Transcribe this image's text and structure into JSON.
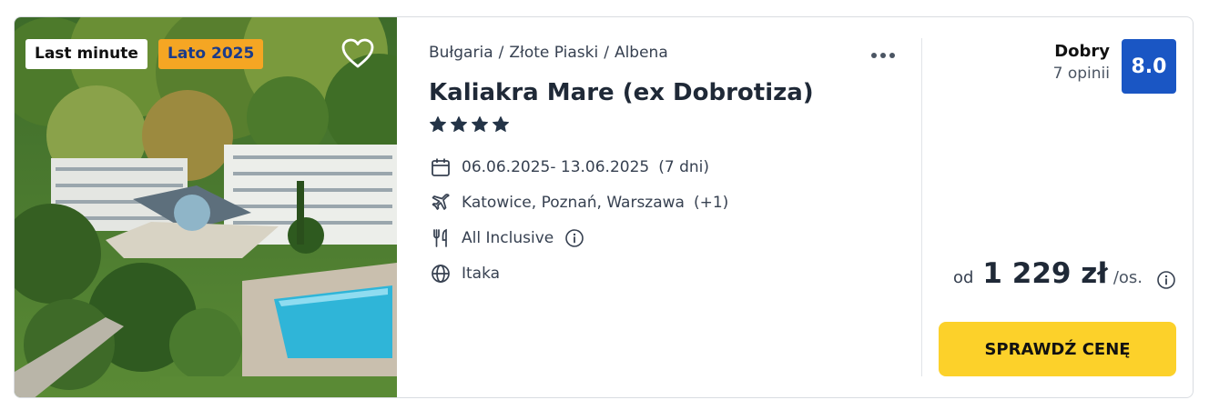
{
  "badges": {
    "last_minute": "Last minute",
    "season": "Lato 2025"
  },
  "breadcrumb": {
    "country": "Bułgaria",
    "sep1": "/",
    "region": "Złote Piaski",
    "sep2": "/",
    "city": "Albena"
  },
  "hotel": {
    "name": "Kaliakra Mare (ex Dobrotiza)",
    "stars": 4
  },
  "details": {
    "dates": "06.06.2025- 13.06.2025",
    "duration": "(7 dni)",
    "departure": "Katowice, Poznań, Warszawa",
    "departure_more": "(+1)",
    "board": "All Inclusive",
    "operator": "Itaka"
  },
  "rating": {
    "word": "Dobry",
    "count": "7 opinii",
    "score": "8.0"
  },
  "price": {
    "prefix": "od",
    "amount": "1 229 zł",
    "unit": "/os."
  },
  "cta": {
    "label": "SPRAWDŹ CENĘ"
  },
  "icons": {
    "heart": "heart-icon",
    "more": "more-icon",
    "star": "star-icon",
    "calendar": "calendar-icon",
    "plane": "plane-icon",
    "cutlery": "cutlery-icon",
    "info": "info-icon",
    "globe": "globe-icon"
  },
  "colors": {
    "score_bg": "#1a56c4",
    "cta_bg": "#fcd12a",
    "season_badge_bg": "#f5a623",
    "season_badge_text": "#1b3b8a"
  }
}
